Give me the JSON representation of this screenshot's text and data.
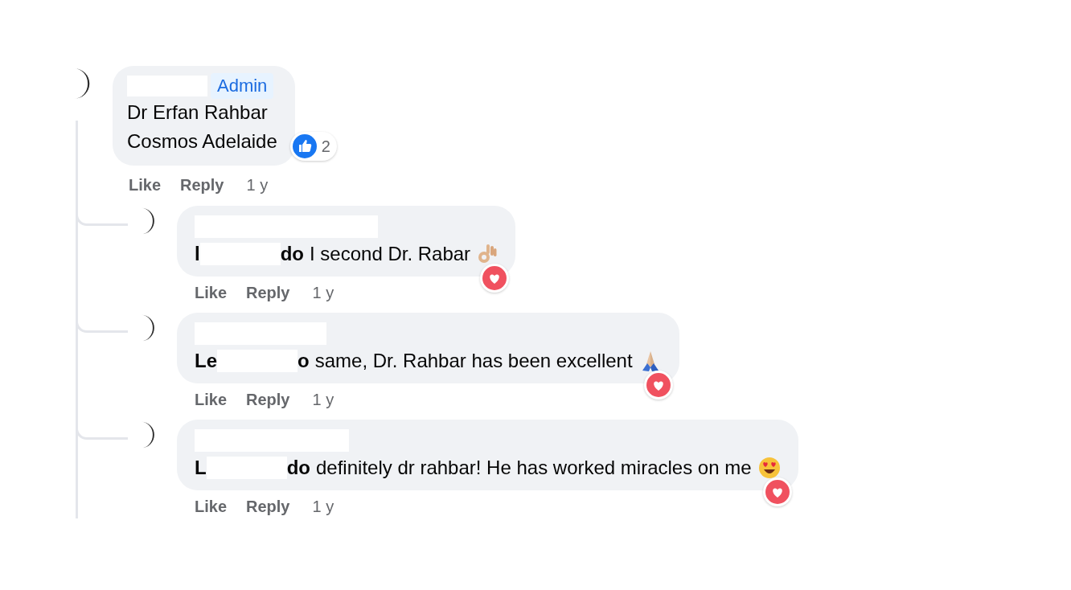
{
  "comment": {
    "badge": "Admin",
    "lines": [
      "Dr Erfan Rahbar",
      "Cosmos Adelaide"
    ],
    "reaction": {
      "kind": "like",
      "count": "2"
    },
    "actions": {
      "like": "Like",
      "reply": "Reply",
      "time": "1 y"
    }
  },
  "replies": [
    {
      "tag_start": "l",
      "tag_end": "do",
      "text": "I second Dr. Rabar",
      "emoji": {
        "kind": "ok"
      },
      "reaction": {
        "kind": "love"
      },
      "actions": {
        "like": "Like",
        "reply": "Reply",
        "time": "1 y"
      }
    },
    {
      "tag_start": "Le",
      "tag_end": "o",
      "text": "same, Dr. Rahbar has been excellent",
      "emoji": {
        "kind": "pray"
      },
      "reaction": {
        "kind": "love"
      },
      "actions": {
        "like": "Like",
        "reply": "Reply",
        "time": "1 y"
      }
    },
    {
      "tag_start": "L",
      "tag_end": "do",
      "text": "definitely dr rahbar! He has worked miracles on me",
      "emoji": {
        "kind": "hearteyes"
      },
      "reaction": {
        "kind": "love"
      },
      "actions": {
        "like": "Like",
        "reply": "Reply",
        "time": "1 y"
      }
    }
  ]
}
